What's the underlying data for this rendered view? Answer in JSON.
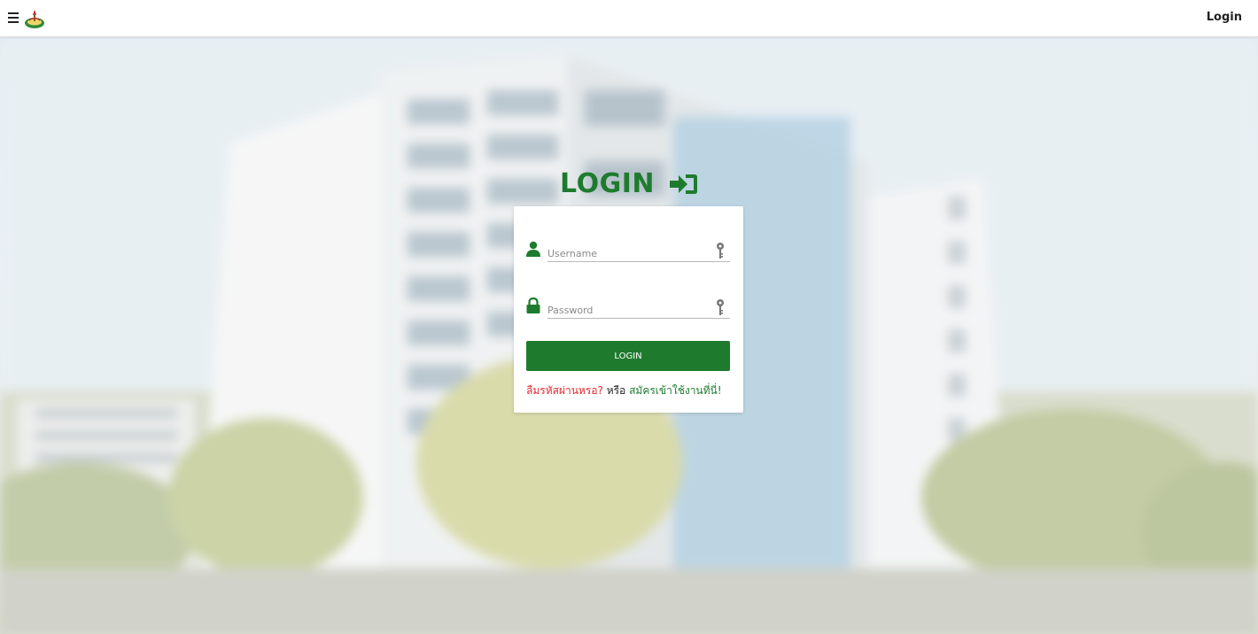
{
  "navbar": {
    "menu_icon": "hamburger-menu-icon",
    "logo_icon": "university-logo-icon",
    "login_label": "Login"
  },
  "login": {
    "title": "LOGIN",
    "title_icon": "sign-in-icon",
    "username_placeholder": "Username",
    "username_icon": "user-icon",
    "password_placeholder": "Password",
    "password_icon": "lock-icon",
    "field_key_icon": "key-icon",
    "button_label": "LOGIN",
    "forgot_text": "ลืมรหัสผ่านหรอ?",
    "or_text": "หรือ",
    "register_text": "สมัครเข้าใช้งานที่นี่!"
  },
  "colors": {
    "primary_green": "#1e7b2e",
    "forgot_red": "#e0262f",
    "navbar_bg": "#ffffff"
  }
}
